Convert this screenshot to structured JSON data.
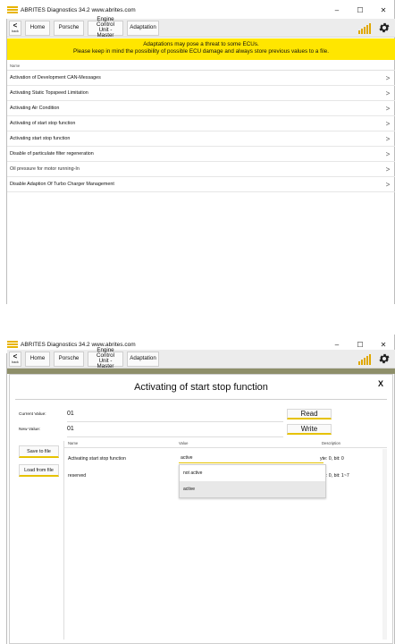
{
  "window": {
    "title": "ABRITES Diagnostics 34.2   www.abrites.com",
    "minimize": "–",
    "maximize": "☐",
    "close": "✕"
  },
  "toolbar": {
    "back_label": "back",
    "home_label": "Home",
    "brand_label": "Porsche",
    "ecu_label_line1": "Engine Control",
    "ecu_label_line2": "Unit - Master",
    "adaptation_label": "Adaptation"
  },
  "warning": {
    "line1": "Adaptations may pose a threat to some ECUs.",
    "line2": "Please keep in mind the possibility of possible ECU damage and always store previous values to a file.",
    "color": "#ffe600"
  },
  "list": {
    "header": "Name",
    "items": [
      {
        "label": "Activation of Development CAN-Messages"
      },
      {
        "label": "Activating Static Topspeed Limitation"
      },
      {
        "label": "Activating Air Condition"
      },
      {
        "label": "Activating of start stop function"
      },
      {
        "label": "Activating start stop function"
      },
      {
        "label": "Disable of particulate filter regeneration"
      },
      {
        "label": "Oil pressure for motor running-In"
      },
      {
        "label": "Disable Adaption Of Turbo Charger Management"
      }
    ],
    "arrow": ">"
  },
  "dialog": {
    "title": "Activating of start stop function",
    "close": "X",
    "current_value_label": "Current Value:",
    "current_value": "01",
    "new_value_label": "New Value:",
    "new_value": "01",
    "read_label": "Read",
    "write_label": "Write",
    "save_label": "Save to file",
    "load_label": "Load from file",
    "table": {
      "col_name": "Name",
      "col_value": "Value",
      "col_description": "Description",
      "rows": [
        {
          "name": "Activating start stop function",
          "value": "active",
          "description": "yte: 0, bit: 0"
        },
        {
          "name": "reserved",
          "value": "",
          "description": "yte: 0, bit: 1~7"
        }
      ]
    },
    "dropdown_options": [
      "not active",
      "active"
    ],
    "dropdown_selected": "active"
  },
  "colors": {
    "accent": "#e6c200",
    "toolbar_bg": "#ececec",
    "olive_band": "#8e8f6a"
  }
}
